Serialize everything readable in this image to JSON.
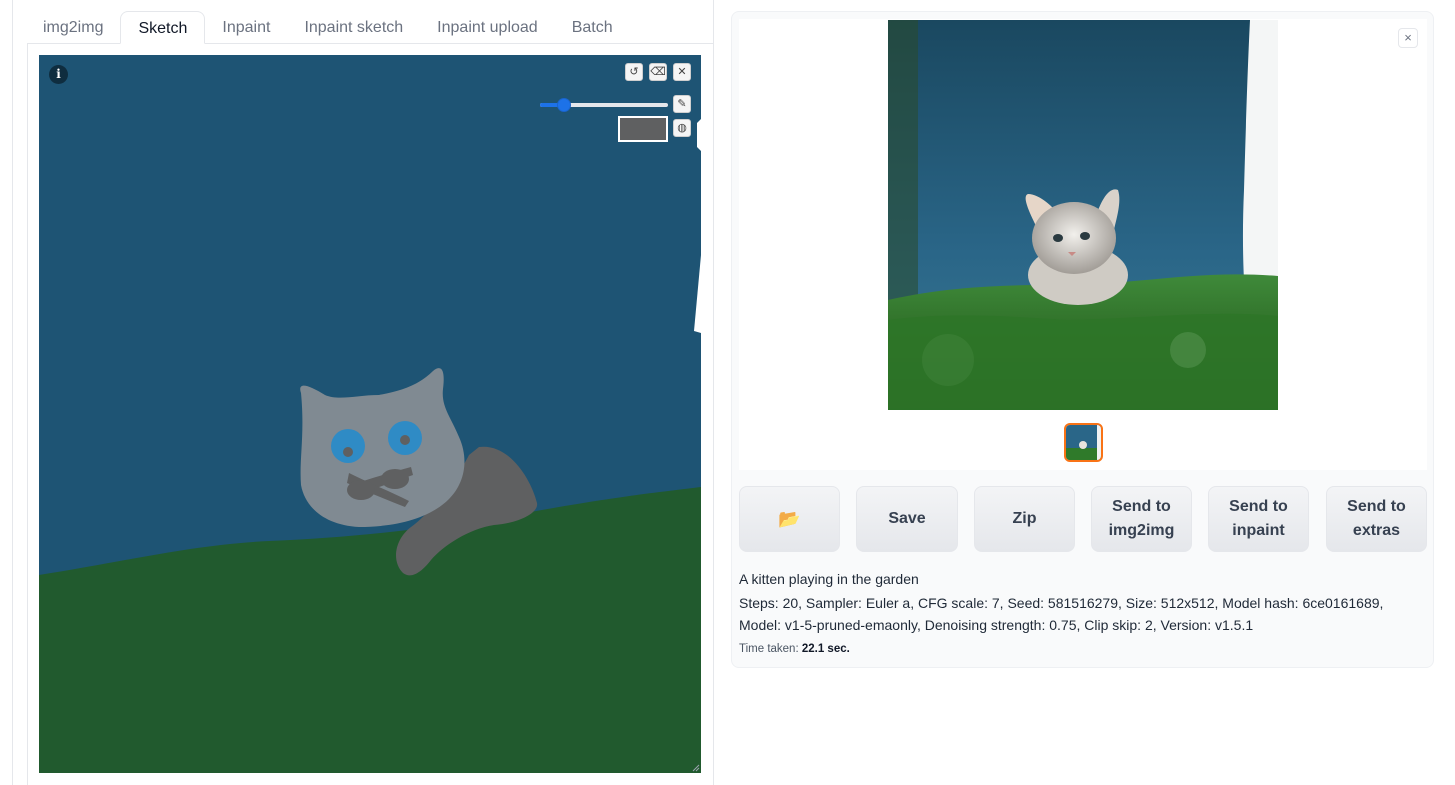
{
  "tabs": [
    {
      "label": "img2img",
      "active": false
    },
    {
      "label": "Sketch",
      "active": true
    },
    {
      "label": "Inpaint",
      "active": false
    },
    {
      "label": "Inpaint sketch",
      "active": false
    },
    {
      "label": "Inpaint upload",
      "active": false
    },
    {
      "label": "Batch",
      "active": false
    }
  ],
  "sketch": {
    "info_icon_label": "i",
    "tools": {
      "undo": "undo-icon",
      "clear": "eraser-icon",
      "remove": "close-icon",
      "brush": "brush-icon",
      "color": "palette-icon"
    },
    "brush_size_fraction": 0.19,
    "brush_color": "#5f6061",
    "canvas_bg": "#1e5474",
    "grass_color": "#215a2e"
  },
  "output": {
    "close_label": "×",
    "buttons": {
      "folder": "📂",
      "save": "Save",
      "zip": "Zip",
      "send_img2img": "Send to img2img",
      "send_inpaint": "Send to inpaint",
      "send_extras": "Send to extras"
    },
    "prompt": "A kitten playing in the garden",
    "params": "Steps: 20, Sampler: Euler a, CFG scale: 7, Seed: 581516279, Size: 512x512, Model hash: 6ce0161689, Model: v1-5-pruned-emaonly, Denoising strength: 0.75, Clip skip: 2, Version: v1.5.1",
    "time_label": "Time taken:",
    "time_value": "22.1 sec."
  },
  "colors": {
    "accent": "#1d72e8",
    "selected_thumb_border": "#f97316"
  }
}
